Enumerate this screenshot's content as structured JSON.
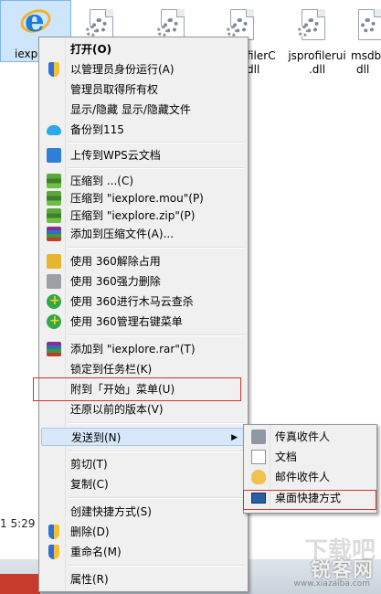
{
  "desktop": {
    "files": [
      {
        "name": "iexplo"
      },
      {
        "name": ""
      },
      {
        "name": ""
      },
      {
        "name_line1": "filerC",
        "name_line2": "dll"
      },
      {
        "name_line1": "jsprofilerui",
        "name_line2": ".dll"
      },
      {
        "name_line1": "msdb",
        "name_line2": "dll"
      }
    ],
    "status_time": "1 5:29",
    "watermark": "锐客网",
    "watermark_bg": "下载吧",
    "watermark_url": "www.xiazaiba.com"
  },
  "context_menu": {
    "items": [
      {
        "label": "打开(O)",
        "icon": ""
      },
      {
        "label": "以管理员身份运行(A)",
        "icon": "shield-icon"
      },
      {
        "label": "管理员取得所有权",
        "icon": ""
      },
      {
        "label": "显示/隐藏 显示/隐藏文件",
        "icon": ""
      },
      {
        "label": "备份到115",
        "icon": "cloud-icon"
      },
      {
        "label": "上传到WPS云文档",
        "icon": "wps-icon"
      },
      {
        "label": "压缩到 ...(C)",
        "icon": "zip-icon"
      },
      {
        "label": "压缩到 \"iexplore.mou\"(P)",
        "icon": "zip-icon"
      },
      {
        "label": "压缩到 \"iexplore.zip\"(P)",
        "icon": "zip-icon"
      },
      {
        "label": "添加到压缩文件(A)...",
        "icon": "rar-icon"
      },
      {
        "label": "使用 360解除占用",
        "icon": "unlock-icon"
      },
      {
        "label": "使用 360强力删除",
        "icon": "shredder-icon"
      },
      {
        "label": "使用 360进行木马云查杀",
        "icon": "360-icon"
      },
      {
        "label": "使用 360管理右键菜单",
        "icon": "360-icon"
      },
      {
        "label": "添加到 \"iexplore.rar\"(T)",
        "icon": "rar-icon"
      },
      {
        "label": "锁定到任务栏(K)",
        "icon": ""
      },
      {
        "label": "附到「开始」菜单(U)",
        "icon": ""
      },
      {
        "label": "还原以前的版本(V)",
        "icon": ""
      },
      {
        "label": "发送到(N)",
        "icon": ""
      },
      {
        "label": "剪切(T)",
        "icon": ""
      },
      {
        "label": "复制(C)",
        "icon": ""
      },
      {
        "label": "创建快捷方式(S)",
        "icon": ""
      },
      {
        "label": "删除(D)",
        "icon": "shield-icon"
      },
      {
        "label": "重命名(M)",
        "icon": "shield-icon"
      },
      {
        "label": "属性(R)",
        "icon": ""
      }
    ]
  },
  "send_to_menu": {
    "items": [
      {
        "label": "传真收件人",
        "icon": "fax-icon"
      },
      {
        "label": "文档",
        "icon": "document-icon"
      },
      {
        "label": "邮件收件人",
        "icon": "mail-icon"
      },
      {
        "label": "桌面快捷方式",
        "icon": "desktop-icon"
      }
    ]
  },
  "colors": {
    "menu_bg": "#f0f0f0",
    "highlight_bg": "#d7e8fb",
    "annotation_red": "#d9302c"
  }
}
